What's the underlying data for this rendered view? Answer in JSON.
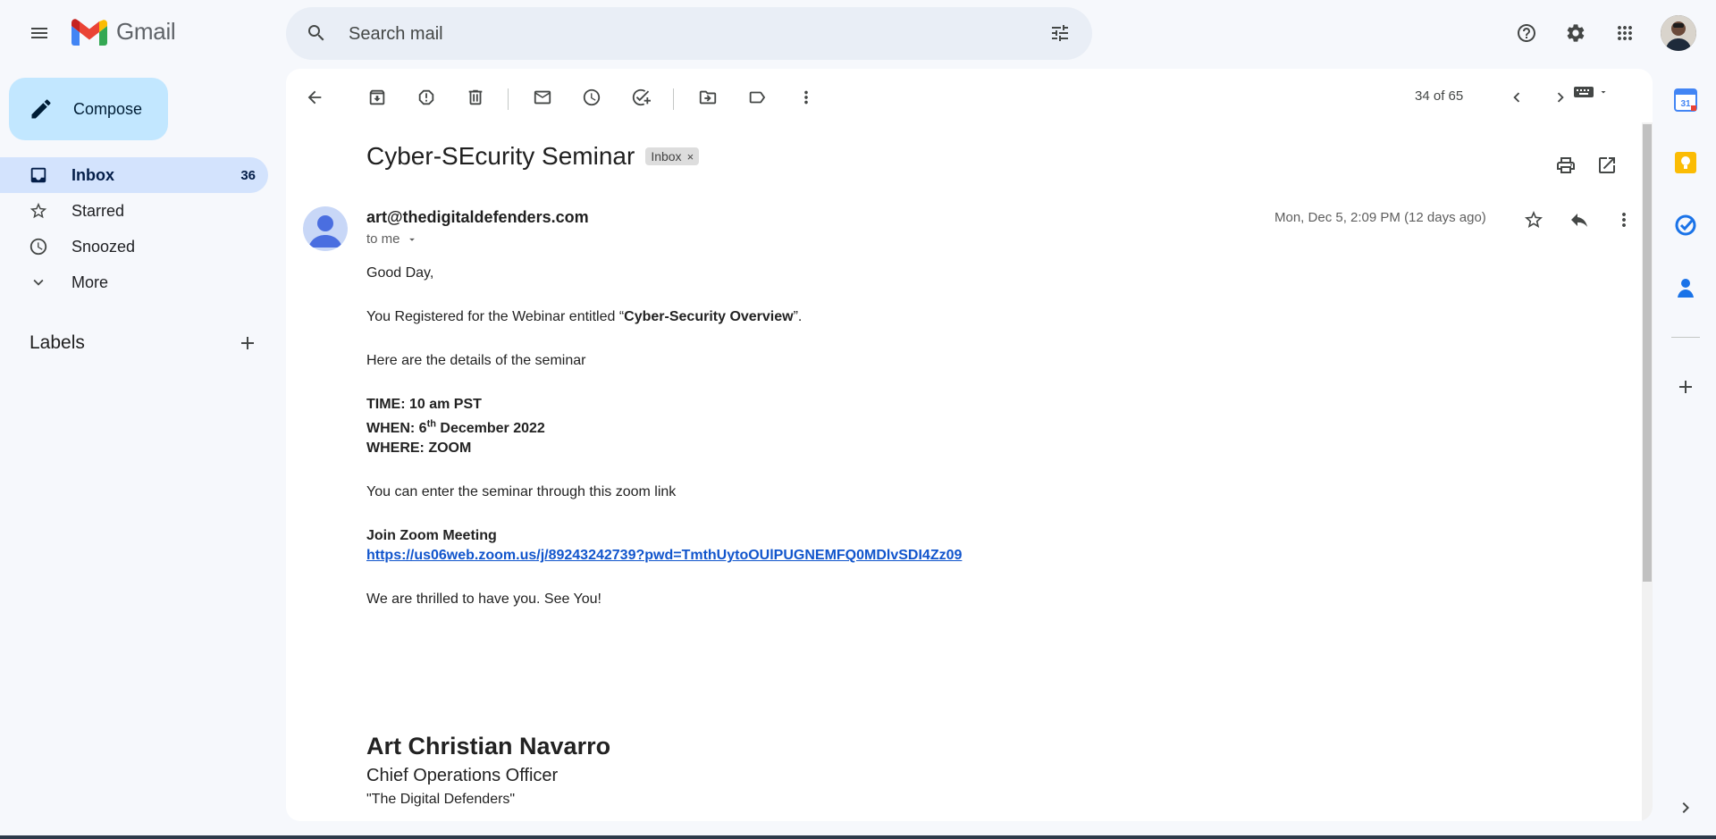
{
  "app": {
    "name": "Gmail"
  },
  "search": {
    "placeholder": "Search mail"
  },
  "compose": {
    "label": "Compose"
  },
  "nav": {
    "inbox": {
      "label": "Inbox",
      "count": "36"
    },
    "starred": {
      "label": "Starred"
    },
    "snoozed": {
      "label": "Snoozed"
    },
    "more": {
      "label": "More"
    }
  },
  "labels": {
    "heading": "Labels"
  },
  "pager": {
    "text": "34 of 65"
  },
  "email": {
    "subject": "Cyber-SEcurity Seminar",
    "label_chip": "Inbox",
    "label_chip_close": "×",
    "sender": "art@thedigitaldefenders.com",
    "recipient": "to me",
    "date": "Mon, Dec 5, 2:09 PM (12 days ago)",
    "greeting": "Good Day,",
    "reg_prefix": "You Registered for the Webinar entitled “",
    "reg_title": "Cyber-Security Overview",
    "reg_suffix": "”.",
    "details_intro": "Here are the details of the seminar",
    "time_line": "TIME: 10 am PST",
    "when_prefix": "WHEN: 6",
    "when_sup": "th",
    "when_suffix": " December 2022",
    "where_line": "WHERE: ZOOM",
    "zoom_intro": "You can enter the seminar through this zoom link",
    "join_heading": "Join Zoom Meeting",
    "zoom_link": "https://us06web.zoom.us/j/89243242739?pwd=TmthUytoOUlPUGNEMFQ0MDlvSDI4Zz09",
    "closing": "We are thrilled to have you. See You!",
    "signature": {
      "name": "Art Christian Navarro",
      "title": "Chief Operations Officer",
      "org": "\"The Digital Defenders\""
    }
  },
  "side_panel": {
    "calendar_day": "31"
  },
  "colors": {
    "background": "#f6f8fc",
    "compose": "#c2e7ff",
    "nav_active": "#d3e3fd",
    "link": "#1155cc"
  }
}
